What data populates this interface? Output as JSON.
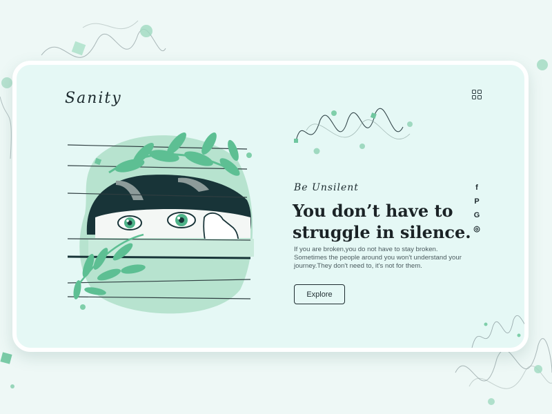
{
  "brand": {
    "logo_text": "Sanity"
  },
  "hero": {
    "tagline": "Be Unsilent",
    "headline": "You don’t have to struggle in silence.",
    "body": "If you are broken,you do not have to stay broken. Sometimes the people around you won't understand your journey.They don't need to, it's not for them.",
    "cta_label": "Explore"
  },
  "socials": [
    {
      "icon": "facebook-icon",
      "glyph": "f"
    },
    {
      "icon": "pinterest-icon",
      "glyph": "P"
    },
    {
      "icon": "g-icon",
      "glyph": "G"
    },
    {
      "icon": "instagram-icon",
      "glyph": "◎"
    }
  ],
  "colors": {
    "page_bg": "#eef8f6",
    "card_bg": "#e5f8f5",
    "accent_green": "#5dbf93",
    "pale_green": "#b7e3cf",
    "ink": "#1c2a2e"
  }
}
